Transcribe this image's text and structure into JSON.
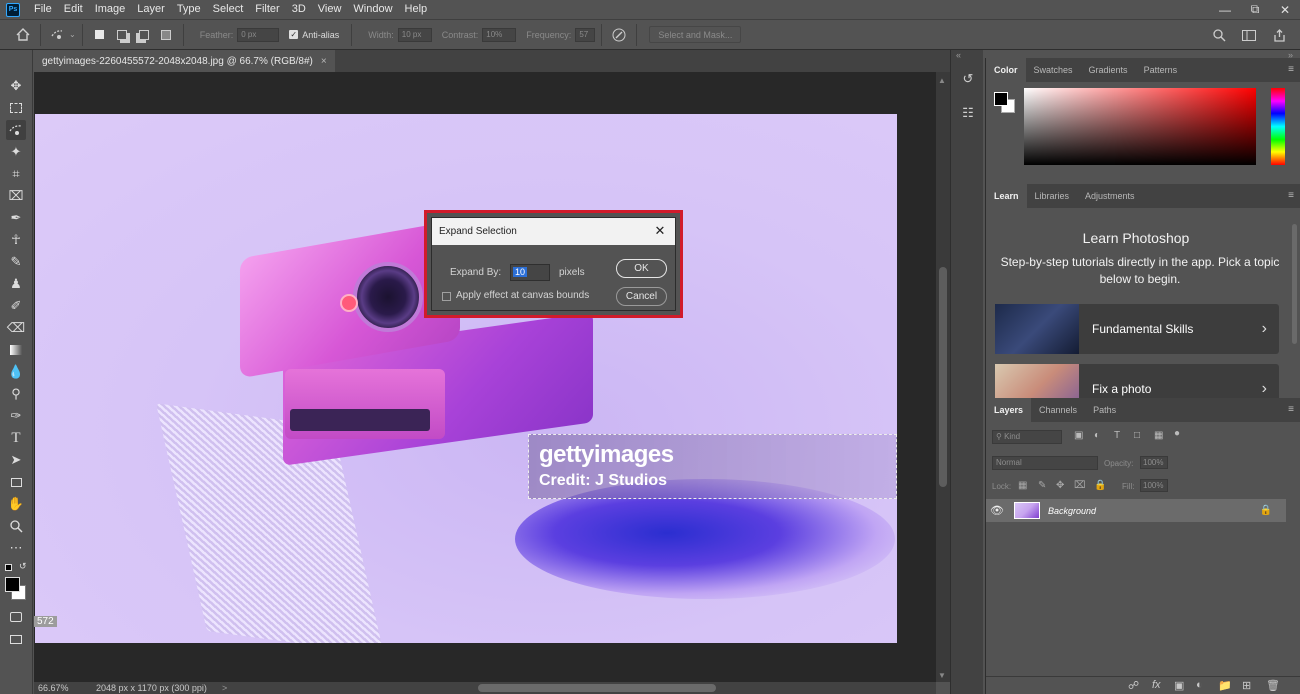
{
  "app": {
    "logo": "Ps"
  },
  "menu": [
    "File",
    "Edit",
    "Image",
    "Layer",
    "Type",
    "Select",
    "Filter",
    "3D",
    "View",
    "Window",
    "Help"
  ],
  "options_bar": {
    "feather_label": "Feather:",
    "feather_value": "0 px",
    "antialias_label": "Anti-alias",
    "width_label": "Width:",
    "width_value": "10 px",
    "contrast_label": "Contrast:",
    "contrast_value": "10%",
    "frequency_label": "Frequency:",
    "frequency_value": "57",
    "select_mask_label": "Select and Mask..."
  },
  "document": {
    "tab_title": "gettyimages-2260455572-2048x2048.jpg @ 66.7% (RGB/8#)",
    "watermark_logo": "gettyimages",
    "watermark_credit": "Credit: J Studios",
    "ruler_num": "572"
  },
  "status": {
    "zoom": "66.67%",
    "size": "2048 px x 1170 px (300 ppi)",
    "arrow": ">"
  },
  "dialog": {
    "title": "Expand Selection",
    "expand_label": "Expand By:",
    "expand_value": "10",
    "unit": "pixels",
    "canvas_bounds_label": "Apply effect at canvas bounds",
    "ok_label": "OK",
    "cancel_label": "Cancel"
  },
  "color_panel": {
    "tabs": [
      "Color",
      "Swatches",
      "Gradients",
      "Patterns"
    ],
    "foreground": "#000000",
    "background": "#ffffff",
    "hue": "#ff0000"
  },
  "learn_panel": {
    "tabs": [
      "Learn",
      "Libraries",
      "Adjustments"
    ],
    "title": "Learn Photoshop",
    "subtitle": "Step-by-step tutorials directly in the app. Pick a topic below to begin.",
    "cards": [
      "Fundamental Skills",
      "Fix a photo"
    ]
  },
  "layers_panel": {
    "tabs": [
      "Layers",
      "Channels",
      "Paths"
    ],
    "kind_placeholder": "Kind",
    "blend_mode": "Normal",
    "opacity_label": "Opacity:",
    "opacity_value": "100%",
    "lock_label": "Lock:",
    "fill_label": "Fill:",
    "fill_value": "100%",
    "layer_name": "Background"
  }
}
